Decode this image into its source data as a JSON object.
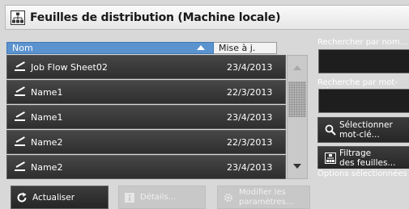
{
  "window": {
    "title": "Feuilles de distribution (Machine locale)"
  },
  "list": {
    "columns": {
      "name": "Nom",
      "date": "Mise à j."
    },
    "rows": [
      {
        "name": "Job Flow Sheet02",
        "date": "23/4/2013"
      },
      {
        "name": "Name1",
        "date": "22/3/2013"
      },
      {
        "name": "Name1",
        "date": "23/4/2013"
      },
      {
        "name": "Name2",
        "date": "22/3/2013"
      },
      {
        "name": "Name2",
        "date": "23/4/2013"
      }
    ]
  },
  "side": {
    "search_name_label": "Rechercher par nom...",
    "search_keyword_label": "Recherche par mot-clé",
    "select_keyword_l1": "Sélectionner",
    "select_keyword_l2": "mot-clé...",
    "filter_l1": "Filtrage",
    "filter_l2": "des feuilles...",
    "options_note": "Options sélectionnées"
  },
  "bottom": {
    "refresh_label": "Actualiser",
    "details_label": "Détails...",
    "modify_l1": "Modifier les",
    "modify_l2": "paramètres..."
  },
  "colors": {
    "accent": "#5b93cf",
    "row_bg": "#363636",
    "panel_bg": "#d8d8d8"
  }
}
